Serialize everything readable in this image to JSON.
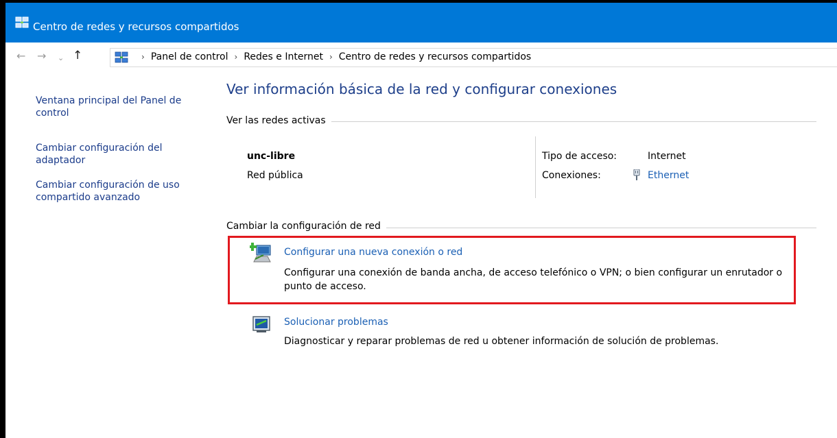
{
  "window": {
    "title": "Centro de redes y recursos compartidos"
  },
  "address": {
    "breadcrumbs": [
      "Panel de control",
      "Redes e Internet",
      "Centro de redes y recursos compartidos"
    ]
  },
  "sidebar": {
    "items": [
      {
        "label": "Ventana principal del Panel de control"
      },
      {
        "label": "Cambiar configuración del adaptador"
      },
      {
        "label": "Cambiar configuración de uso compartido avanzado"
      }
    ]
  },
  "main": {
    "heading": "Ver información básica de la red y configurar conexiones",
    "active_networks": {
      "section_title": "Ver las redes activas",
      "network_name": "unc-libre",
      "network_type": "Red pública",
      "access_type_label": "Tipo de acceso:",
      "access_type_value": "Internet",
      "connections_label": "Conexiones:",
      "connection_value": "Ethernet"
    },
    "change_settings": {
      "section_title": "Cambiar la configuración de red",
      "tasks": [
        {
          "label": "Configurar una nueva conexión o red",
          "description": "Configurar una conexión de banda ancha, de acceso telefónico o VPN; o bien configurar un enrutador o punto de acceso."
        },
        {
          "label": "Solucionar problemas",
          "description": "Diagnosticar y reparar problemas de red u obtener información de solución de problemas."
        }
      ]
    }
  },
  "colors": {
    "titlebar": "#0078d7",
    "link": "#1a5fb4",
    "heading": "#1e3f8a",
    "highlight": "#e2191f"
  },
  "icons": {
    "app": "network-center-icon",
    "back": "arrow-left-icon",
    "forward": "arrow-right-icon",
    "recent": "chevron-down-icon",
    "up": "arrow-up-icon",
    "ethernet": "ethernet-plug-icon",
    "new_connection": "new-connection-icon",
    "troubleshoot": "troubleshoot-icon"
  }
}
